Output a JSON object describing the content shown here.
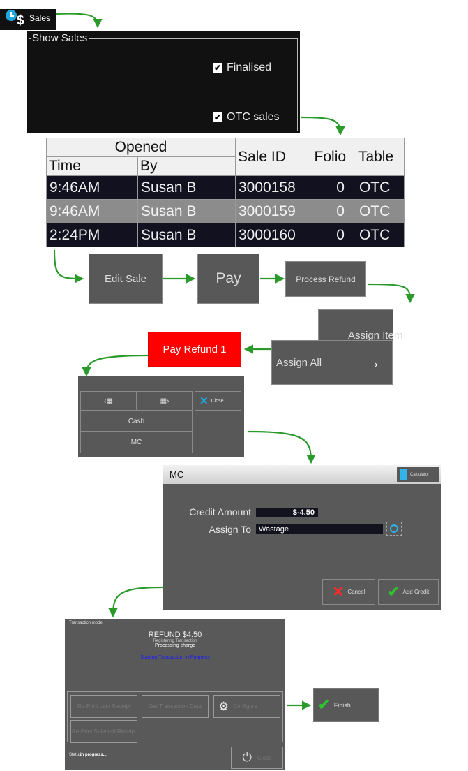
{
  "sales_button": {
    "label": "Sales",
    "icon": "clock-dollar-icon"
  },
  "show_sales": {
    "legend": "Show Sales",
    "checkboxes": [
      {
        "label": "Finalised",
        "checked": true
      },
      {
        "label": "OTC sales",
        "checked": true
      }
    ]
  },
  "sales_table": {
    "group_header": "Opened",
    "columns": [
      "Time",
      "By",
      "Sale ID",
      "Folio",
      "Table"
    ],
    "rows": [
      {
        "time": "9:46AM",
        "by": "Susan B",
        "sale_id": "3000158",
        "folio": "0",
        "table": "OTC",
        "selected": false
      },
      {
        "time": "9:46AM",
        "by": "Susan B",
        "sale_id": "3000159",
        "folio": "0",
        "table": "OTC",
        "selected": true
      },
      {
        "time": "2:24PM",
        "by": "Susan B",
        "sale_id": "3000160",
        "folio": "0",
        "table": "OTC",
        "selected": false
      }
    ]
  },
  "flow_buttons": {
    "edit_sale": "Edit Sale",
    "pay": "Pay",
    "process_refund": "Process Refund",
    "assign_item": "Assign Item",
    "assign_all": "Assign All",
    "assign_all_arrow": "→",
    "pay_refund": "Pay Refund 1"
  },
  "colors": {
    "accent_green": "#2a9a2a",
    "pay_refund_red": "#ff0000",
    "panel_grey": "#595959"
  },
  "payment_panel": {
    "prev_page": "‹▦",
    "next_page": "▦›",
    "close": "Close",
    "methods": [
      "Cash",
      "MC"
    ]
  },
  "mc_dialog": {
    "title": "MC",
    "calculator_label": "Calculator",
    "credit_amount_label": "Credit Amount",
    "credit_amount_value": "$-4.50",
    "assign_to_label": "Assign To",
    "assign_to_value": "Wastage",
    "cancel_label": "Cancel",
    "add_credit_label": "Add Credit"
  },
  "transaction_panel": {
    "mode_label": "Transaction mode",
    "headline": "REFUND $4.50",
    "line1": "Registering Transaction",
    "line2": "Processing charge",
    "progress_message": "Starting Transaction in Progress",
    "buttons": [
      "Re-Print Last Receipt",
      "Get Transaction Data",
      "Configure",
      "Re-Print Selected Receipt"
    ],
    "status_label": "Status:",
    "status_value": "in progress...",
    "close_label": "Close"
  },
  "finish_button": {
    "label": "Finish"
  }
}
